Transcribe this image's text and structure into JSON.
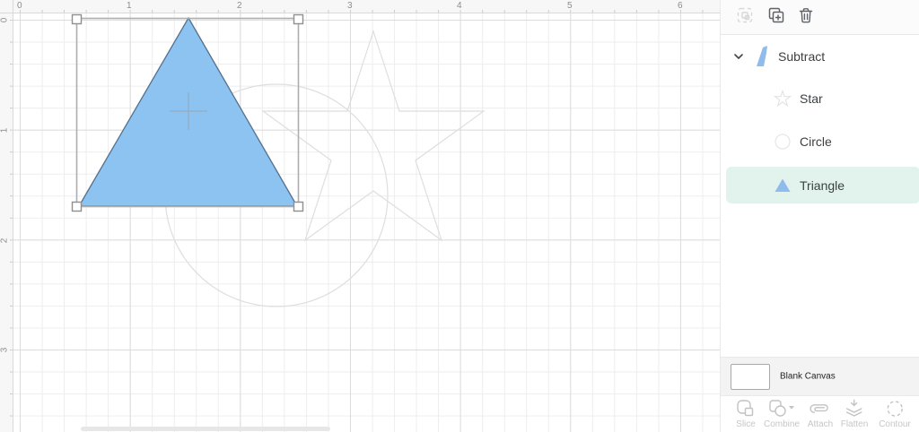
{
  "canvas": {
    "h_ruler": [
      "0",
      "1",
      "2",
      "3",
      "4",
      "5",
      "6"
    ],
    "v_ruler": [
      "0",
      "1",
      "2",
      "3"
    ]
  },
  "layers_panel": {
    "toolbar": {
      "icons": [
        {
          "name": "select-group-icon",
          "disabled": true
        },
        {
          "name": "duplicate-icon",
          "disabled": false
        },
        {
          "name": "trash-icon",
          "disabled": false
        }
      ]
    },
    "group": {
      "label": "Subtract",
      "expanded": true,
      "icon": "subtract-result-icon"
    },
    "items": [
      {
        "label": "Star",
        "icon": "star-outline-icon",
        "selected": false
      },
      {
        "label": "Circle",
        "icon": "circle-outline-icon",
        "selected": false
      },
      {
        "label": "Triangle",
        "icon": "triangle-filled-icon",
        "selected": true
      }
    ]
  },
  "canvas_row": {
    "label": "Blank Canvas"
  },
  "action_bar": {
    "items": [
      {
        "label": "Slice",
        "icon": "slice-icon"
      },
      {
        "label": "Combine",
        "icon": "combine-icon",
        "has_dropdown": true
      },
      {
        "label": "Attach",
        "icon": "attach-icon"
      },
      {
        "label": "Flatten",
        "icon": "flatten-icon"
      },
      {
        "label": "Contour",
        "icon": "contour-icon"
      }
    ]
  },
  "colors": {
    "shape_blue": "#8cc3f0",
    "shape_blue_stroke": "#55708c",
    "sidebar_blue": "#8fbcec",
    "selected_row_bg": "#e1f3ec",
    "ghost_stroke": "#dedede"
  }
}
